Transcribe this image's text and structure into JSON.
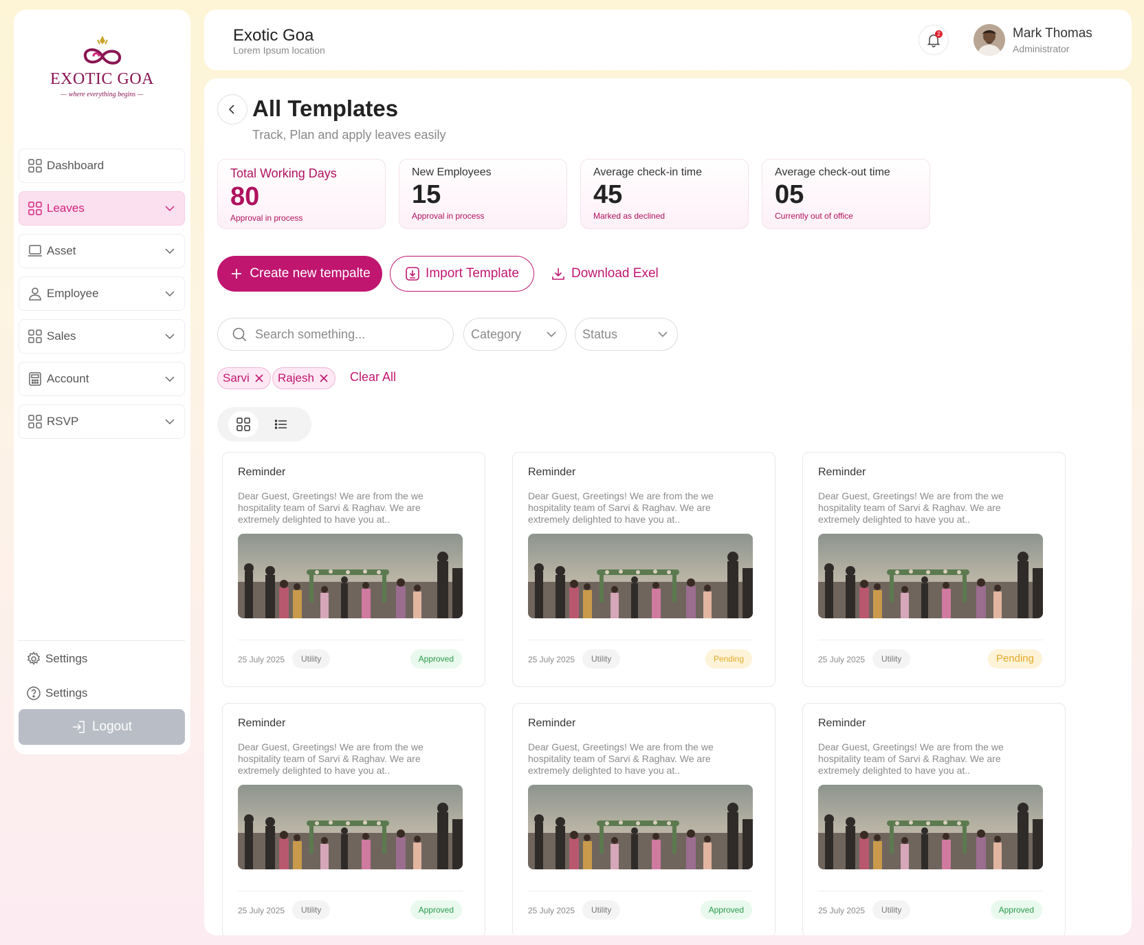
{
  "brand": {
    "name": "EXOTIC GOA",
    "tagline": "— where everything begins —"
  },
  "sidebar": {
    "items": [
      {
        "label": "Dashboard",
        "icon": "grid-icon",
        "active": false,
        "has_chevron": false
      },
      {
        "label": "Leaves",
        "icon": "grid-icon",
        "active": true,
        "has_chevron": true
      },
      {
        "label": "Asset",
        "icon": "laptop-icon",
        "active": false,
        "has_chevron": true
      },
      {
        "label": "Employee",
        "icon": "user-icon",
        "active": false,
        "has_chevron": true
      },
      {
        "label": "Sales",
        "icon": "grid-icon",
        "active": false,
        "has_chevron": true
      },
      {
        "label": "Account",
        "icon": "calculator-icon",
        "active": false,
        "has_chevron": true
      },
      {
        "label": "RSVP",
        "icon": "grid-icon",
        "active": false,
        "has_chevron": true
      }
    ],
    "settings_label": "Settings",
    "help_label": "Settings",
    "logout_label": "Logout"
  },
  "header": {
    "title": "Exotic Goa",
    "subtitle": "Lorem Ipsum location",
    "notification_count": "2",
    "user_name": "Mark Thomas",
    "user_role": "Administrator"
  },
  "page": {
    "title": "All Templates",
    "subtitle": "Track, Plan  and apply leaves easily"
  },
  "stats": [
    {
      "label": "Total Working Days",
      "value": "80",
      "note": "Approval in process"
    },
    {
      "label": "New Employees",
      "value": "15",
      "note": "Approval in process"
    },
    {
      "label": "Average check-in time",
      "value": "45",
      "note": "Marked as declined"
    },
    {
      "label": "Average check-out time",
      "value": "05",
      "note": "Currently out of office"
    }
  ],
  "actions": {
    "create_label": "Create new tempalte",
    "import_label": "Import Template",
    "download_label": "Download Exel"
  },
  "filters": {
    "search_placeholder": "Search something...",
    "category_label": "Category",
    "status_label": "Status",
    "chips": [
      "Sarvi",
      "Rajesh"
    ],
    "clear_label": "Clear All"
  },
  "colors": {
    "primary": "#c01670",
    "active_bg": "#fbe0ef",
    "approved": "#2b9b4a",
    "pending": "#e3a92a"
  },
  "cards": [
    {
      "title": "Reminder",
      "body": "Dear Guest, Greetings! We are from the we hospitality team of Sarvi & Raghav. We are extremely delighted to have you at..",
      "date": "25 July 2025",
      "tag": "Utility",
      "status": "Approved"
    },
    {
      "title": "Reminder",
      "body": "Dear Guest, Greetings! We are from the we hospitality team of Sarvi & Raghav. We are extremely delighted to have you at..",
      "date": "25 July 2025",
      "tag": "Utility",
      "status": "Pending"
    },
    {
      "title": "Reminder",
      "body": "Dear Guest, Greetings! We are from the we hospitality team of Sarvi & Raghav. We are extremely delighted to have you at..",
      "date": "25 July 2025",
      "tag": "Utility",
      "status": "Pending"
    },
    {
      "title": "Reminder",
      "body": "Dear Guest, Greetings! We are from the we hospitality team of Sarvi & Raghav. We are extremely delighted to have you at..",
      "date": "25 July 2025",
      "tag": "Utility",
      "status": "Approved"
    },
    {
      "title": "Reminder",
      "body": "Dear Guest, Greetings! We are from the we hospitality team of Sarvi & Raghav. We are extremely delighted to have you at..",
      "date": "25 July 2025",
      "tag": "Utility",
      "status": "Approved"
    },
    {
      "title": "Reminder",
      "body": "Dear Guest, Greetings! We are from the we hospitality team of Sarvi & Raghav. We are extremely delighted to have you at..",
      "date": "25 July 2025",
      "tag": "Utility",
      "status": "Approved"
    }
  ]
}
